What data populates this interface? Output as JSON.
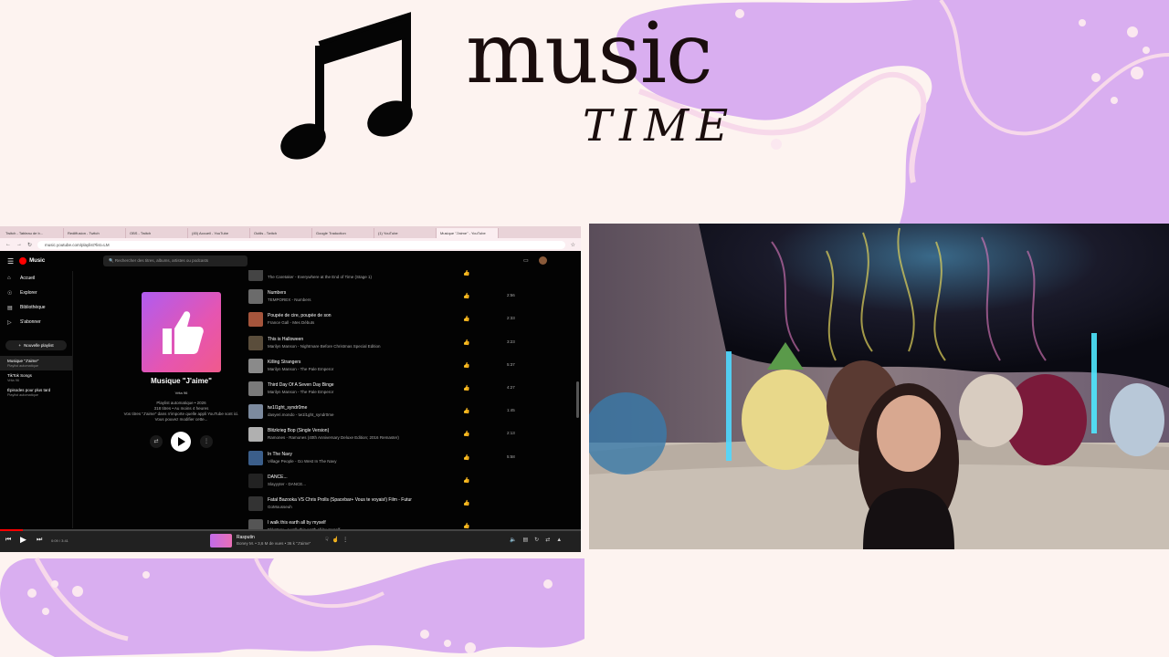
{
  "banner": {
    "title_music": "music",
    "title_time": "TIME"
  },
  "colors": {
    "background": "#fdf3f0",
    "blob_purple": "#d9aef0",
    "ytm_red": "#ff0000"
  },
  "browser": {
    "tabs": [
      {
        "label": "Twitch - Tableau de b..."
      },
      {
        "label": "Rediffusion - Twitch"
      },
      {
        "label": "OBS - Twitch"
      },
      {
        "label": "(45) Accueil - YouTube"
      },
      {
        "label": "Outils - Twitch"
      },
      {
        "label": "Google Traduction"
      },
      {
        "label": "(1) YouTube"
      },
      {
        "label": "Musique \"J'aime\" - YouTube"
      }
    ],
    "url": "music.youtube.com/playlist?list=LM"
  },
  "ytm": {
    "logo": "Music",
    "search_placeholder": "Rechercher des titres, albums, artistes ou podcasts",
    "nav": [
      {
        "label": "Accueil",
        "icon": "home-icon"
      },
      {
        "label": "Explorer",
        "icon": "compass-icon"
      },
      {
        "label": "Bibliothèque",
        "icon": "library-icon"
      },
      {
        "label": "S'abonner",
        "icon": "subscriptions-icon"
      }
    ],
    "new_playlist": "Nouvelle playlist",
    "playlists": [
      {
        "title": "Musique \"J'aime\"",
        "sub": "Playlist automatique"
      },
      {
        "title": "TikTok Songs",
        "sub": "Vrita 96"
      },
      {
        "title": "Épisodes pour plus tard",
        "sub": "Playlist automatique"
      }
    ],
    "playlist": {
      "title": "Musique \"J'aime\"",
      "owner": "Vrita 96",
      "meta1": "Playlist automatique • 2026",
      "meta2": "318 titres • Au moins 4 heures",
      "meta3": "Vos titres \"J'aime\" dans n'importe quelle appli YouTube sont ici. Vous pouvez modifier cette..."
    },
    "tracks": [
      {
        "title": "",
        "artist": "The Caretaker - Everywhere at the End of Time (Stage 1)",
        "duration": "",
        "color": "#444"
      },
      {
        "title": "Numbers",
        "artist": "TEMPOREX - Numbers",
        "duration": "2:56",
        "color": "#6b6b6b"
      },
      {
        "title": "Poupée de cire, poupée de son",
        "artist": "France Gall - Mes Débuts",
        "duration": "2:33",
        "color": "#a5553c"
      },
      {
        "title": "This is Halloween",
        "artist": "Marilyn Manson - Nightmare Before Christmas Special Edition",
        "duration": "3:23",
        "color": "#5a4d3b"
      },
      {
        "title": "Killing Strangers",
        "artist": "Marilyn Manson - The Pale Emperor",
        "duration": "5:37",
        "color": "#8a8a8a"
      },
      {
        "title": "Third Day Of A Seven Day Binge",
        "artist": "Marilyn Manson - The Pale Emperor",
        "duration": "4:27",
        "color": "#7a7a7a"
      },
      {
        "title": "tw1l1ght_syndr0me",
        "artist": "dasyeri.mondo - tw1l1ght_syndr0me",
        "duration": "1:45",
        "color": "#7c8a9e"
      },
      {
        "title": "Blitzkrieg Bop (Single Version)",
        "artist": "Ramones - Ramones (40th Anniversary Deluxe Edition; 2016 Remaster)",
        "duration": "2:13",
        "color": "#b0b0b0"
      },
      {
        "title": "In The Navy",
        "artist": "Village People - Go West In The Navy",
        "duration": "5:58",
        "color": "#3b5e8a"
      },
      {
        "title": "DANCE...",
        "artist": "Slayyyter - DANCE...",
        "duration": "",
        "color": "#222"
      },
      {
        "title": "Fatal Bazooka VS Chris Prolls (Spacebar+ Vous te voyais!) Film - Futur",
        "artist": "GoMousseuh",
        "duration": "",
        "color": "#333"
      },
      {
        "title": "I walk this earth all by myself",
        "artist": "Ekkstacy - I walk this earth all by myself",
        "duration": "",
        "color": "#555"
      }
    ],
    "player": {
      "time": "0:09 / 3:41",
      "progress": 0.04,
      "now_playing_title": "Rasputin",
      "now_playing_sub": "Boney M. • 3,6 M de vues • 36 k \"J'aime\""
    }
  },
  "webcam": {
    "description_icon": "webcam-feed"
  }
}
